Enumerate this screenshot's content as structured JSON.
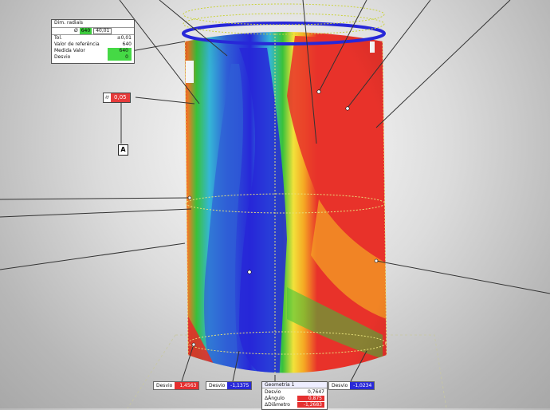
{
  "dim_box": {
    "title": "Dim. radiais",
    "radius_symbol": "Ø",
    "radius_value": "640",
    "radius_input": "40,01",
    "rows": [
      {
        "label": "Tol.",
        "value": "±0,01"
      },
      {
        "label": "Valor de referência",
        "value": "640"
      },
      {
        "label": "Medida Valor",
        "value": "640"
      },
      {
        "label": "Desvio",
        "value": "0"
      }
    ]
  },
  "tolerance_box": {
    "symbol": "⌭",
    "value": "0,05"
  },
  "datum": {
    "label": "A"
  },
  "deviation_labels": [
    {
      "key": "Desvio",
      "value": "1,4563",
      "color": "#e53030"
    },
    {
      "key": "Desvio",
      "value": "-1,1375",
      "color": "#2a2ad8"
    },
    {
      "key": "Desvio",
      "value": "-1,0234",
      "color": "#2a2ad8"
    }
  ],
  "bottom_box": {
    "title": "Geometria 1",
    "rows": [
      {
        "label": "Desvio",
        "value": "0,7647"
      },
      {
        "label": "ΔÂngulo",
        "value": "0,875"
      },
      {
        "label": "ΔDiâmetro",
        "value": "-1,2683"
      }
    ]
  },
  "colors": {
    "red": "#e8322a",
    "orange": "#f5a623",
    "yellow": "#f3e23a",
    "green": "#39c23a",
    "cyan": "#35b6d6",
    "blue": "#2727d8",
    "annotation_line": "#333333"
  }
}
